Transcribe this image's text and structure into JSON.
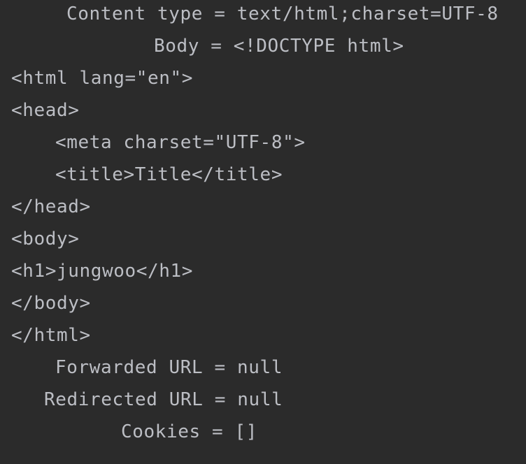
{
  "colors": {
    "background": "#2b2b2b",
    "text": "#bcbec4"
  },
  "output": {
    "content_type_line": "Content type = text/html;charset=UTF-8",
    "body_line": "Body = <!DOCTYPE html>",
    "html_lines": [
      "<html lang=\"en\">",
      "<head>",
      "<meta charset=\"UTF-8\">",
      "<title>Title</title>",
      "</head>",
      "<body>",
      "<h1>jungwoo</h1>",
      "</body>",
      "</html>"
    ],
    "forwarded_url_line": "Forwarded URL = null",
    "redirected_url_line": "Redirected URL = null",
    "cookies_line": "Cookies = []"
  }
}
